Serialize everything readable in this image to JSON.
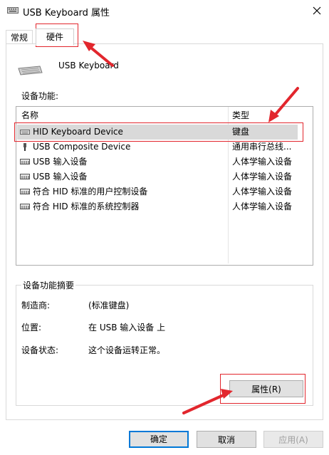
{
  "window": {
    "title": "USB Keyboard 属性"
  },
  "tabs": [
    {
      "label": "常规",
      "active": false
    },
    {
      "label": "硬件",
      "active": true
    }
  ],
  "device": {
    "name": "USB Keyboard"
  },
  "functions_section": {
    "label": "设备功能:",
    "columns": [
      "名称",
      "类型"
    ],
    "rows": [
      {
        "name": "HID Keyboard Device",
        "type": "键盘",
        "icon": "keyboard-icon",
        "selected": true
      },
      {
        "name": "USB Composite Device",
        "type": "通用串行总线...",
        "icon": "usb-plug-icon",
        "selected": false
      },
      {
        "name": "USB 输入设备",
        "type": "人体学输入设备",
        "icon": "hid-device-icon",
        "selected": false
      },
      {
        "name": "USB 输入设备",
        "type": "人体学输入设备",
        "icon": "hid-device-icon",
        "selected": false
      },
      {
        "name": "符合 HID 标准的用户控制设备",
        "type": "人体学输入设备",
        "icon": "hid-device-icon",
        "selected": false
      },
      {
        "name": "符合 HID 标准的系统控制器",
        "type": "人体学输入设备",
        "icon": "hid-device-icon",
        "selected": false
      }
    ]
  },
  "summary": {
    "title": "设备功能摘要",
    "manufacturer_label": "制造商:",
    "manufacturer_value": "(标准键盘)",
    "location_label": "位置:",
    "location_value": "在 USB 输入设备 上",
    "status_label": "设备状态:",
    "status_value": "这个设备运转正常。",
    "properties_button": "属性(R)"
  },
  "footer": {
    "ok": "确定",
    "cancel": "取消",
    "apply": "应用(A)"
  },
  "colors": {
    "annotation_red": "#e2262d",
    "selection_gray": "#d9d9d9",
    "focus_blue": "#0078d7"
  }
}
